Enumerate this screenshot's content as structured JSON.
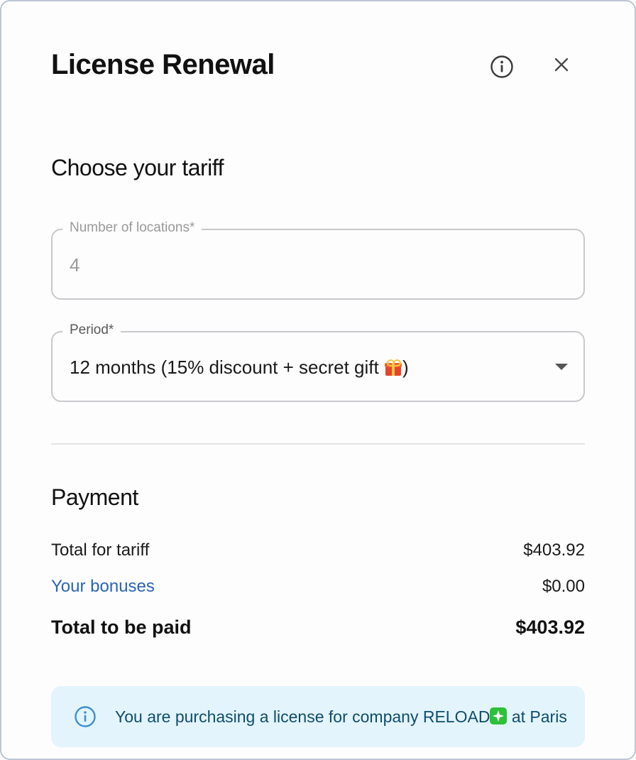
{
  "dialog": {
    "title": "License Renewal"
  },
  "tariff": {
    "heading": "Choose your tariff",
    "locations_label": "Number of locations*",
    "locations_value": "4",
    "period_label": "Period*",
    "period_value_before": "12 months (15% discount + secret gift ",
    "period_value_after": ")",
    "period_icon": "gift-icon"
  },
  "payment": {
    "heading": "Payment",
    "rows": [
      {
        "label": "Total for tariff",
        "value": "$403.92"
      },
      {
        "label": "Your bonuses",
        "value": "$0.00"
      },
      {
        "label": "Total to be paid",
        "value": "$403.92"
      }
    ]
  },
  "notice": {
    "text_before": "You are purchasing a license for company RELOAD",
    "text_after": " at Paris",
    "inline_icon": "sparkle-icon"
  },
  "colors": {
    "accent_link": "#2a65b8",
    "notice_bg": "#e3f4fc",
    "notice_text": "#0f4d6b"
  }
}
